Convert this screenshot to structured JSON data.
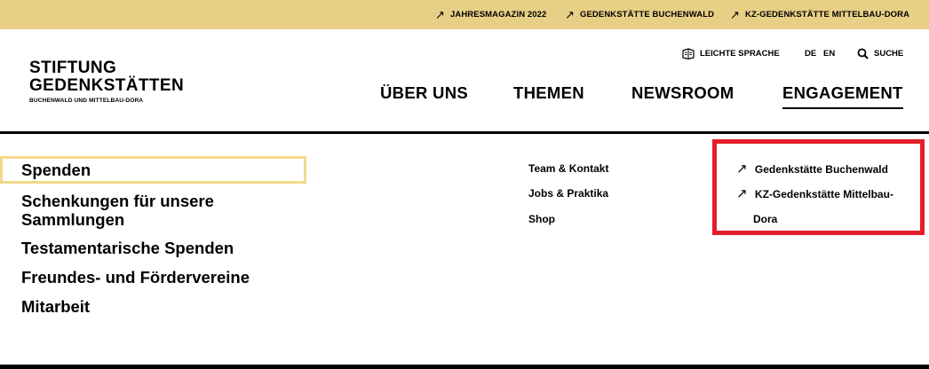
{
  "topbar": {
    "links": [
      {
        "arrow": "↗",
        "label": "JAHRESMAGAZIN 2022"
      },
      {
        "arrow": "↗",
        "label": "GEDENKSTÄTTE BUCHENWALD"
      },
      {
        "arrow": "↗",
        "label": "KZ-GEDENKSTÄTTE MITTELBAU-DORA"
      }
    ]
  },
  "logo": {
    "line1": "STIFTUNG",
    "line2": "GEDENKSTÄTTEN",
    "line3": "BUCHENWALD UND MITTELBAU-DORA"
  },
  "utility": {
    "easy_language": "LEICHTE SPRACHE",
    "lang_de": "DE",
    "lang_en": "EN",
    "search": "SUCHE"
  },
  "nav": {
    "items": [
      "ÜBER UNS",
      "THEMEN",
      "NEWSROOM",
      "ENGAGEMENT"
    ],
    "active": "ENGAGEMENT"
  },
  "menu": {
    "primary": [
      "Spenden",
      "Schenkungen für unsere",
      "Sammlungen",
      "Testamentarische Spenden",
      "Freundes- und Fördervereine",
      "Mitarbeit"
    ],
    "secondary": [
      "Team & Kontakt",
      "Jobs & Praktika",
      "Shop"
    ],
    "external": [
      {
        "arrow": "↗",
        "label": "Gedenkstätte Buchenwald"
      },
      {
        "arrow": "↗",
        "label": "KZ-Gedenkstätte Mittelbau-"
      },
      {
        "arrow": "",
        "label": "Dora"
      }
    ]
  },
  "colors": {
    "topbar_bg": "#e8cf86",
    "highlight_border": "#f3d98c",
    "annotation_red": "#e61e2b"
  }
}
